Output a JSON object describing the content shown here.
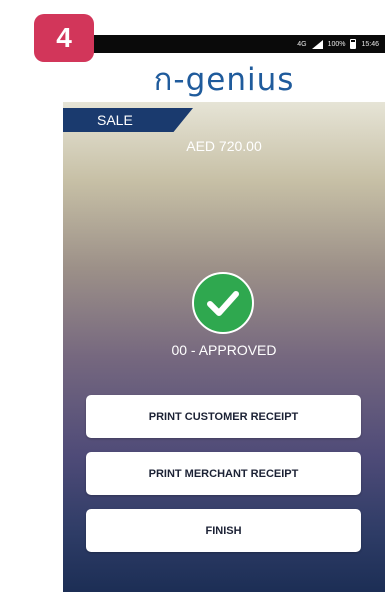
{
  "step": {
    "number": "4"
  },
  "status_bar": {
    "network": "4G",
    "battery": "100%",
    "time": "15:46"
  },
  "header": {
    "logo_text": "ก-genius"
  },
  "transaction": {
    "type_label": "SALE",
    "amount": "AED 720.00"
  },
  "result": {
    "icon": "checkmark-icon",
    "status_text": "00 - APPROVED",
    "color": "#2fa84f"
  },
  "actions": {
    "print_customer": "PRINT CUSTOMER RECEIPT",
    "print_merchant": "PRINT MERCHANT RECEIPT",
    "finish": "FINISH"
  },
  "colors": {
    "badge": "#d2365a",
    "brand_blue": "#1f5b9c",
    "sale_tab": "#1a3a6e"
  }
}
